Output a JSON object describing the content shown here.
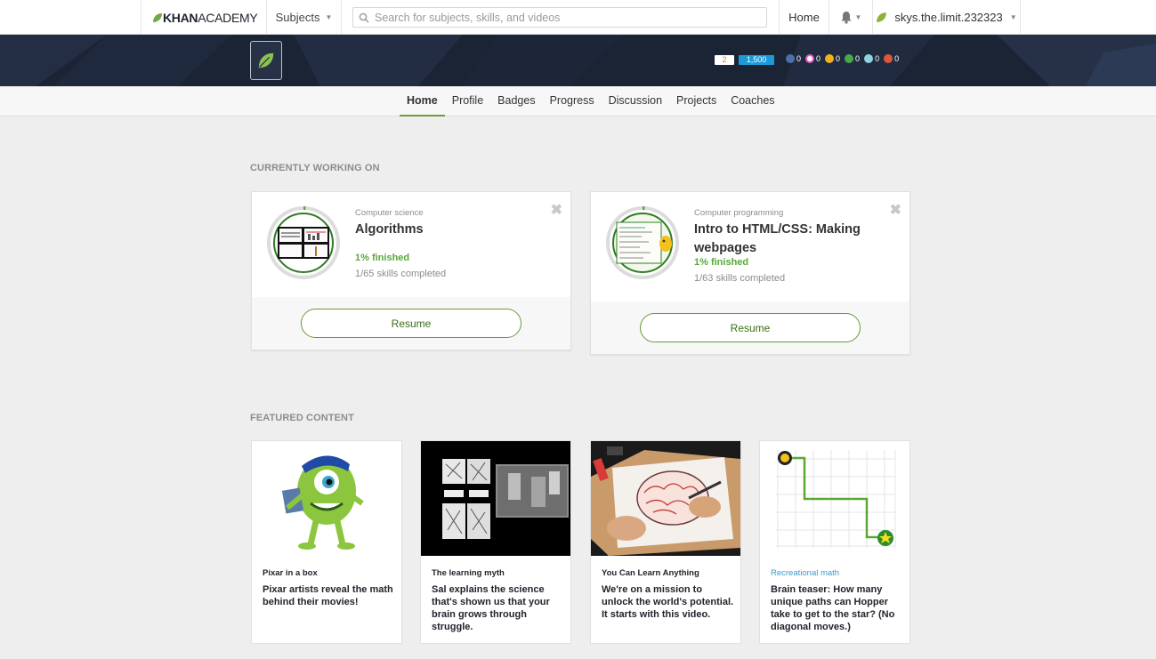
{
  "nav": {
    "logo_khan": "KHAN",
    "logo_academy": "ACADEMY",
    "subjects_label": "Subjects",
    "search_placeholder": "Search for subjects, skills, and videos",
    "home_label": "Home",
    "username": "skys.the.limit.232323"
  },
  "banner": {
    "streak": "2",
    "points": "1,500",
    "badges": [
      {
        "color": "#4f6fa8",
        "count": "0"
      },
      {
        "color": "#e05bbf",
        "count": "0"
      },
      {
        "color": "#f2b01e",
        "count": "0"
      },
      {
        "color": "#4aa84a",
        "count": "0"
      },
      {
        "color": "#8fd3e0",
        "count": "0"
      },
      {
        "color": "#e0563a",
        "count": "0"
      }
    ]
  },
  "tabs": [
    {
      "label": "Home",
      "active": true
    },
    {
      "label": "Profile",
      "active": false
    },
    {
      "label": "Badges",
      "active": false
    },
    {
      "label": "Progress",
      "active": false
    },
    {
      "label": "Discussion",
      "active": false
    },
    {
      "label": "Projects",
      "active": false
    },
    {
      "label": "Coaches",
      "active": false
    }
  ],
  "working_on": {
    "heading": "CURRENTLY WORKING ON",
    "courses": [
      {
        "category": "Computer science",
        "title": "Algorithms",
        "progress_label": "1% finished",
        "progress": 0.01,
        "skills": "1/65 skills completed",
        "button": "Resume"
      },
      {
        "category": "Computer programming",
        "title": "Intro to HTML/CSS: Making webpages",
        "progress_label": "1% finished",
        "progress": 0.01,
        "skills": "1/63 skills completed",
        "button": "Resume"
      }
    ]
  },
  "featured": {
    "heading": "FEATURED CONTENT",
    "items": [
      {
        "kicker": "Pixar in a box",
        "description": "Pixar artists reveal the math behind their movies!"
      },
      {
        "kicker": "The learning myth",
        "description": "Sal explains the science that's shown us that your brain grows through struggle."
      },
      {
        "kicker": "You Can Learn Anything",
        "description": "We're on a mission to unlock the world's potential. It starts with this video."
      },
      {
        "kicker": "Recreational math",
        "description": "Brain teaser: How many unique paths can Hopper take to get to the star? (No diagonal moves.)"
      }
    ]
  },
  "colors": {
    "brand_green": "#6e9e35",
    "banner_bg": "#1b2435",
    "points_blue": "#1c9ad8"
  }
}
